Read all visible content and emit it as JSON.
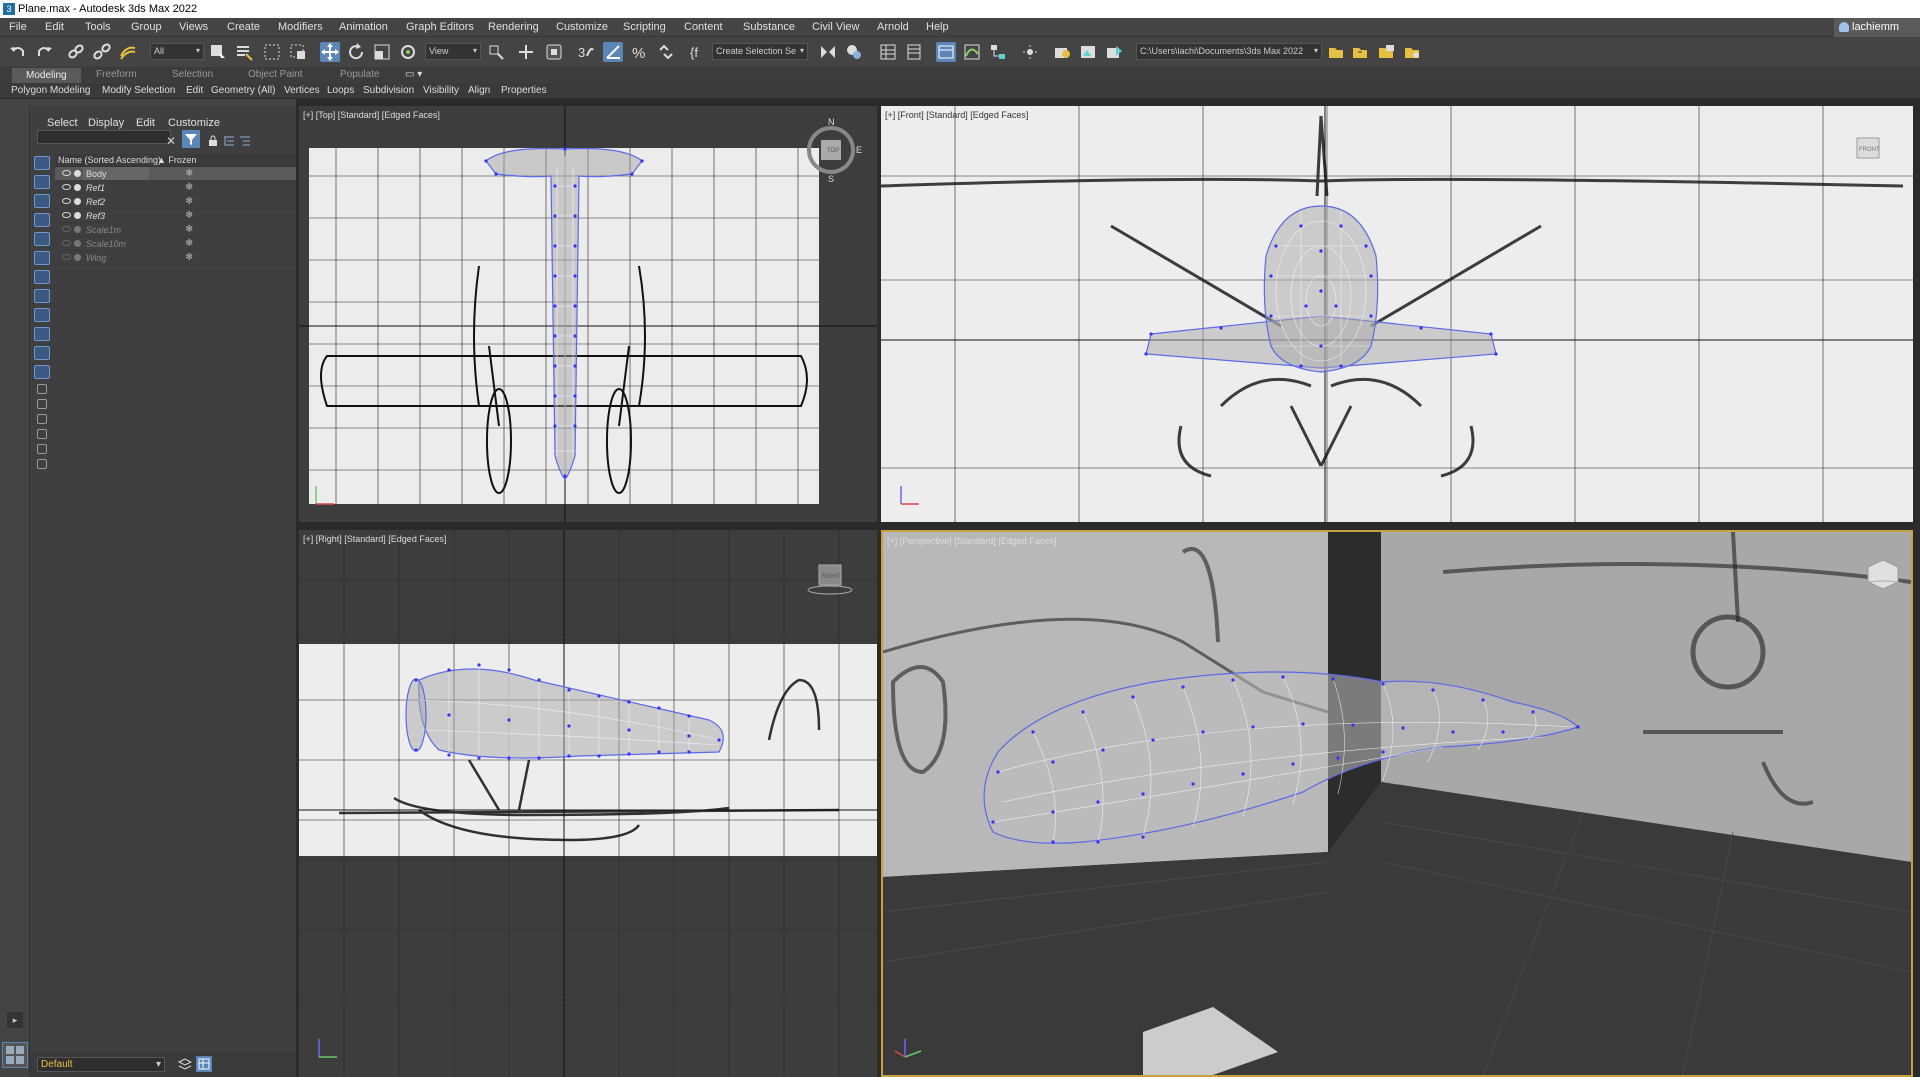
{
  "window": {
    "title": "Plane.max - Autodesk 3ds Max 2022"
  },
  "menu": {
    "items": [
      "File",
      "Edit",
      "Tools",
      "Group",
      "Views",
      "Create",
      "Modifiers",
      "Animation",
      "Graph Editors",
      "Rendering",
      "Customize",
      "Scripting",
      "Content",
      "Substance",
      "Civil View",
      "Arnold",
      "Help"
    ],
    "user": "lachiemm"
  },
  "toolbar": {
    "selection_filter": "All",
    "ref_coord": "View",
    "named_selection": "Create Selection Se",
    "project_path": "C:\\Users\\lachi\\Documents\\3ds Max 2022"
  },
  "ribbon": {
    "tabs": [
      "Modeling",
      "Freeform",
      "Selection",
      "Object Paint",
      "Populate"
    ],
    "active_tab": "Modeling",
    "panels": [
      "Polygon Modeling",
      "Modify Selection",
      "Edit",
      "Geometry (All)",
      "Vertices",
      "Loops",
      "Subdivision",
      "Visibility",
      "Align",
      "Properties"
    ]
  },
  "scene_explorer": {
    "tabs": [
      "Select",
      "Display",
      "Edit",
      "Customize"
    ],
    "col_name": "Name (Sorted Ascending)",
    "col_frozen": "▲ Frozen",
    "rows": [
      {
        "name": "Body",
        "visible": true,
        "selected": true
      },
      {
        "name": "Ref1",
        "visible": true,
        "selected": false
      },
      {
        "name": "Ref2",
        "visible": true,
        "selected": false
      },
      {
        "name": "Ref3",
        "visible": true,
        "selected": false
      },
      {
        "name": "Scale1m",
        "visible": false,
        "selected": false
      },
      {
        "name": "Scale10m",
        "visible": false,
        "selected": false
      },
      {
        "name": "Wing",
        "visible": false,
        "selected": false
      }
    ],
    "frozen_glyph": "❄"
  },
  "layer": {
    "current": "Default"
  },
  "viewports": {
    "top": "[+] [Top] [Standard] [Edged Faces]",
    "front": "[+] [Front] [Standard] [Edged Faces]",
    "right": "[+] [Right] [Standard] [Edged Faces]",
    "perspective": "[+] [Perspective] [Standard] [Edged Faces]"
  },
  "viewcube": {
    "top_face": "TOP",
    "front_face": "FRONT",
    "right_face": "RIGHT",
    "compass_n": "N",
    "compass_s": "S",
    "compass_e": "E"
  },
  "colors": {
    "accent": "#5b87b8",
    "wire_vertex": "#3b3bff",
    "active_viewport_border": "#c8a040"
  }
}
